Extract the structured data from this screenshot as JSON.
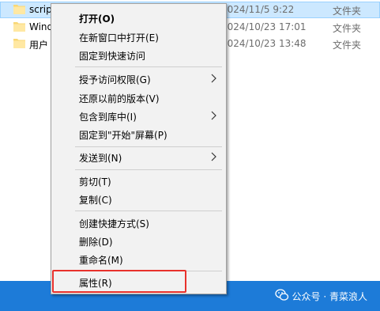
{
  "files": [
    {
      "name": "scrip",
      "date": "2024/11/5 9:22",
      "type": "文件夹",
      "selected": true
    },
    {
      "name": "Wind",
      "date": "2024/10/23 17:01",
      "type": "文件夹",
      "selected": false
    },
    {
      "name": "用户",
      "date": "2024/10/23 13:48",
      "type": "文件夹",
      "selected": false
    }
  ],
  "menu": {
    "open": "打开(O)",
    "open_new_window": "在新窗口中打开(E)",
    "pin_quick_access": "固定到快速访问",
    "grant_access": "授予访问权限(G)",
    "restore_versions": "还原以前的版本(V)",
    "include_library": "包含到库中(I)",
    "pin_start": "固定到\"开始\"屏幕(P)",
    "send_to": "发送到(N)",
    "cut": "剪切(T)",
    "copy": "复制(C)",
    "create_shortcut": "创建快捷方式(S)",
    "delete": "删除(D)",
    "rename": "重命名(M)",
    "properties": "属性(R)"
  },
  "taskbar": {
    "watermark": "公众号 · 青菜浪人"
  },
  "colors": {
    "selection": "#cce8ff",
    "taskbar": "#1d7bd8",
    "highlight": "#e8312c",
    "folder": "#f8d775"
  },
  "icons": {
    "folder": "folder-icon",
    "submenu": "chevron-right-icon",
    "watermark": "wechat-icon"
  }
}
